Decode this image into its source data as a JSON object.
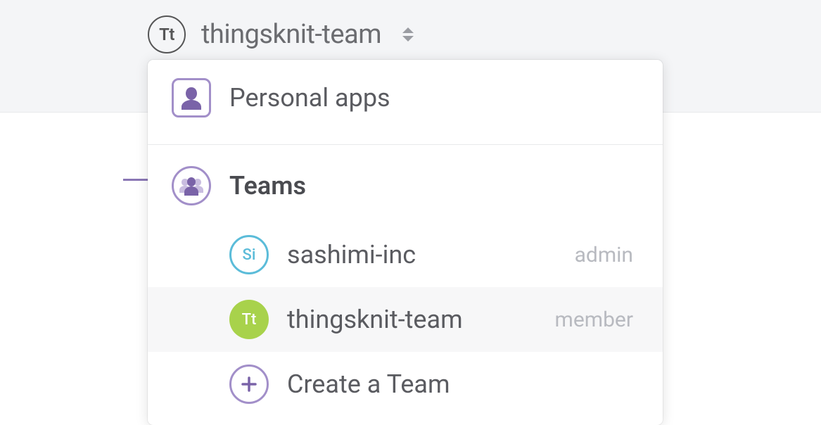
{
  "selector": {
    "avatar_text": "Tt",
    "label": "thingsknit-team"
  },
  "dropdown": {
    "personal_label": "Personal apps",
    "teams_header": "Teams",
    "teams": [
      {
        "avatar": "Si",
        "name": "sashimi-inc",
        "role": "admin",
        "style": "blue",
        "selected": false
      },
      {
        "avatar": "Tt",
        "name": "thingsknit-team",
        "role": "member",
        "style": "green",
        "selected": true
      }
    ],
    "create_label": "Create a Team"
  }
}
